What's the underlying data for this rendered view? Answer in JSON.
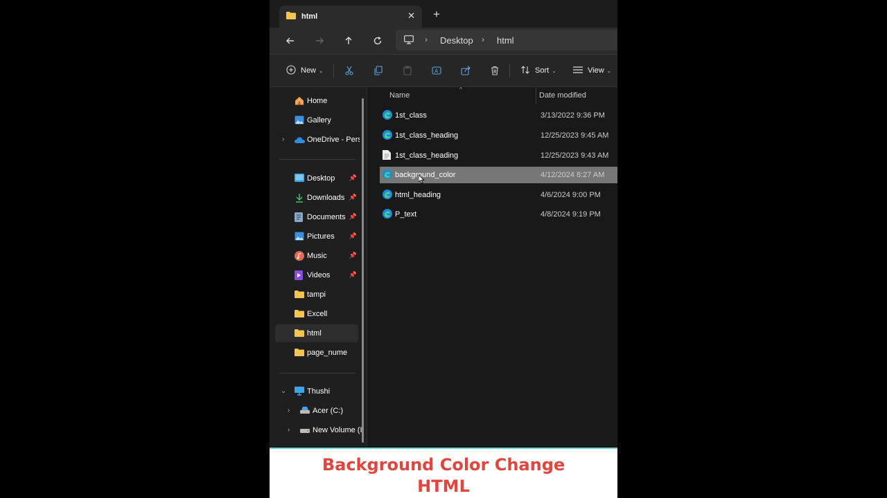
{
  "tab": {
    "title": "html",
    "close_icon": "close-icon",
    "add_icon": "plus-icon"
  },
  "address": {
    "crumbs": [
      "Desktop",
      "html"
    ]
  },
  "toolbar": {
    "new_label": "New",
    "sort_label": "Sort",
    "view_label": "View"
  },
  "sidebar": {
    "quick": [
      {
        "label": "Home",
        "icon": "home-icon"
      },
      {
        "label": "Gallery",
        "icon": "gallery-icon"
      },
      {
        "label": "OneDrive - Perso",
        "icon": "onedrive-icon"
      }
    ],
    "pinned": [
      {
        "label": "Desktop",
        "icon": "desktop-folder-icon"
      },
      {
        "label": "Downloads",
        "icon": "download-icon"
      },
      {
        "label": "Documents",
        "icon": "documents-icon"
      },
      {
        "label": "Pictures",
        "icon": "pictures-icon"
      },
      {
        "label": "Music",
        "icon": "music-icon"
      },
      {
        "label": "Videos",
        "icon": "videos-icon"
      }
    ],
    "folders": [
      "tampi",
      "Excell",
      "html",
      "page_nume"
    ],
    "this_pc": {
      "label": "Thushi",
      "drives": [
        "Acer (C:)",
        "New Volume (I"
      ]
    }
  },
  "file_list": {
    "columns": {
      "name": "Name",
      "date": "Date modified"
    },
    "rows": [
      {
        "name": "1st_class",
        "date": "3/13/2022 9:36 PM",
        "icon": "edge-html-icon"
      },
      {
        "name": "1st_class_heading",
        "date": "12/25/2023 9:45 AM",
        "icon": "edge-html-icon"
      },
      {
        "name": "1st_class_heading",
        "date": "12/25/2023 9:43 AM",
        "icon": "text-file-icon"
      },
      {
        "name": "background_color",
        "date": "4/12/2024 8:27 AM",
        "icon": "edge-html-icon",
        "selected": true
      },
      {
        "name": "html_heading",
        "date": "4/6/2024 9:00 PM",
        "icon": "edge-html-icon"
      },
      {
        "name": "P_text",
        "date": "4/8/2024 9:19 PM",
        "icon": "edge-html-icon"
      }
    ]
  },
  "caption": {
    "line1": "Background Color Change",
    "line2": "HTML",
    "color": "#e0463d"
  },
  "colors": {
    "selection": "#777777",
    "folder": "#f5c451",
    "edge_blue": "#1e8ad6",
    "accent_border": "#69d1d9"
  }
}
